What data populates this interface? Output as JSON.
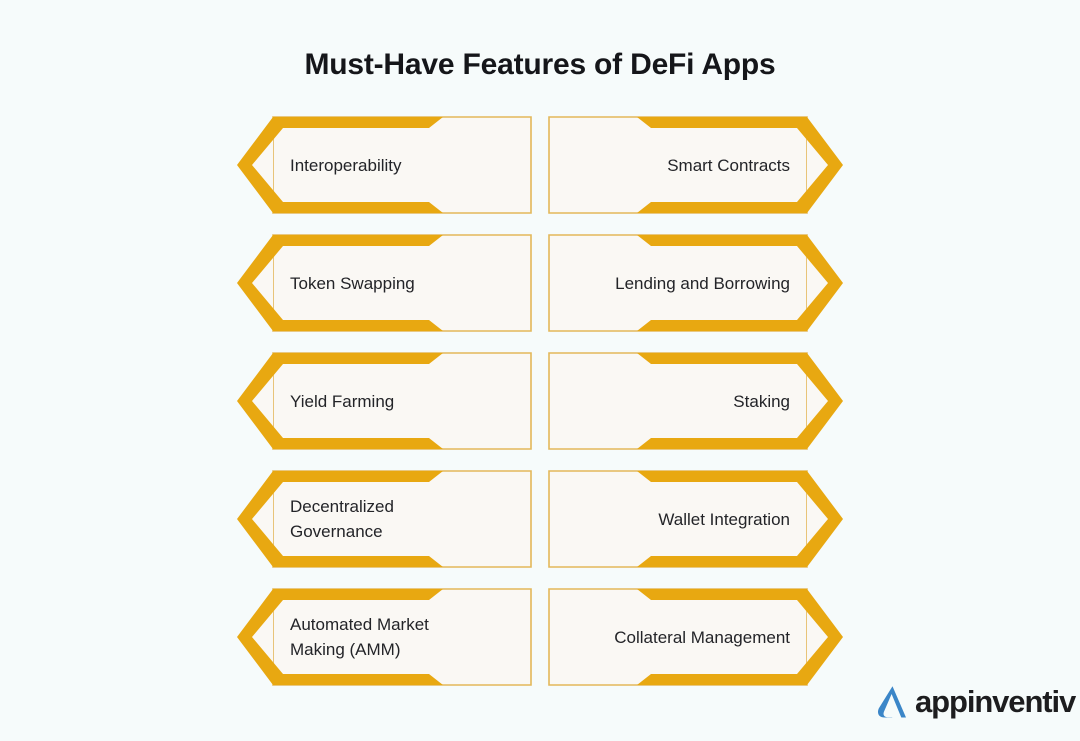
{
  "page": {
    "title": "Must-Have Features of DeFi Apps",
    "background_color": "#f6fbfb"
  },
  "theme": {
    "accent_gold": "#e8a811",
    "card_fill": "#faf8f4",
    "card_thin_border": "#e3b85a",
    "text_color": "#232428",
    "title_color": "#15161a",
    "logo_blue": "#3b86c8"
  },
  "features": {
    "column_left": [
      {
        "label": "Interoperability",
        "direction": "left"
      },
      {
        "label": "Token Swapping",
        "direction": "left"
      },
      {
        "label": "Yield Farming",
        "direction": "left"
      },
      {
        "label": "Decentralized\nGovernance",
        "direction": "left"
      },
      {
        "label": "Automated Market\nMaking (AMM)",
        "direction": "left"
      }
    ],
    "column_right": [
      {
        "label": "Smart Contracts",
        "direction": "right"
      },
      {
        "label": "Lending and Borrowing",
        "direction": "right"
      },
      {
        "label": "Staking",
        "direction": "right"
      },
      {
        "label": "Wallet Integration",
        "direction": "right"
      },
      {
        "label": "Collateral Management",
        "direction": "right"
      }
    ]
  },
  "logo": {
    "wordmark": "appinventiv",
    "mark_name": "appinventiv-a-mark"
  }
}
